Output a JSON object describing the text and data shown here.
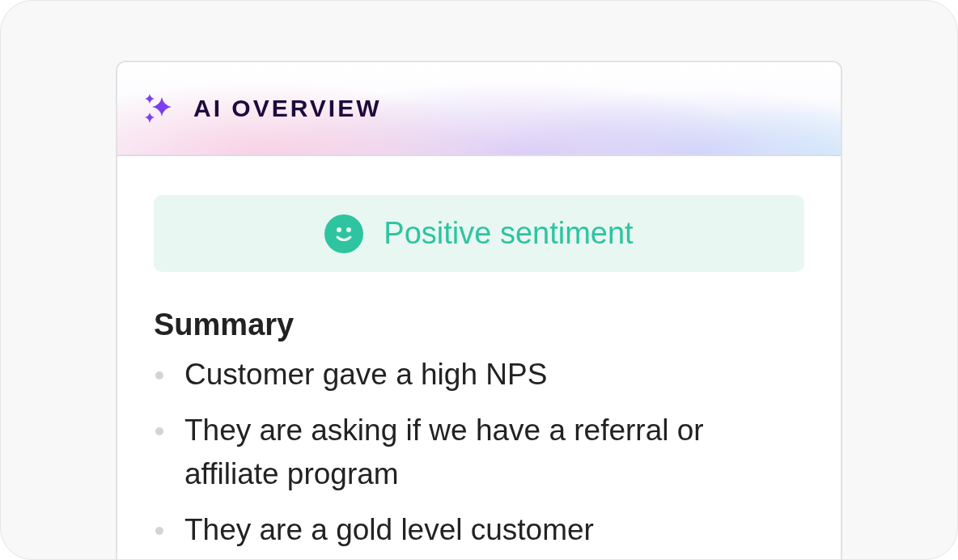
{
  "panel": {
    "title": "AI OVERVIEW"
  },
  "sentiment": {
    "kind": "positive",
    "label": "Positive sentiment"
  },
  "summary": {
    "heading": "Summary",
    "items": [
      "Customer gave a high NPS",
      "They are asking if we have a referral or affiliate program",
      "They are a gold level customer"
    ]
  }
}
